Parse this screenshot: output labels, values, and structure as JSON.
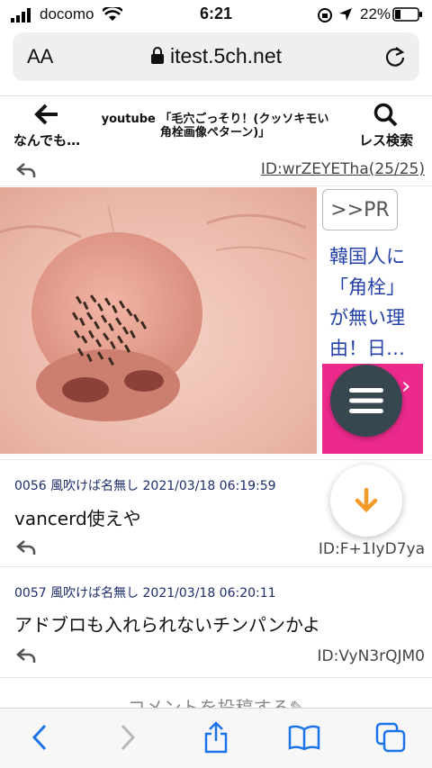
{
  "status_bar": {
    "carrier": "docomo",
    "time": "6:21",
    "battery": "22%"
  },
  "url_bar": {
    "text_size_label": "AA",
    "url": "itest.5ch.net"
  },
  "header": {
    "left_label": "なんでも…",
    "title": "youtube 「毛穴ごっそり！(クッソキモい角栓画像ペターン)」",
    "right_label": "レス検索"
  },
  "prev_post": {
    "id": "ID:wrZEYETha(25/25)"
  },
  "ad": {
    "pr_label": ">>PR",
    "headline": "韓国人に「角栓」が無い理由！日…"
  },
  "posts": [
    {
      "meta": "0056 風吹けば名無し 2021/03/18 06:19:59",
      "body": "vancerd使えや",
      "id": "ID:F+1IyD7ya"
    },
    {
      "meta": "0057 風吹けば名無し 2021/03/18 06:20:11",
      "body": "アドブロも入れられないチンパンかよ",
      "id": "ID:VyN3rQJM0"
    }
  ],
  "comment_prompt": "コメントを投稿する",
  "colors": {
    "accent_pink": "#ec2a8c",
    "link_blue": "#2542a8",
    "fab_dark": "#37474f",
    "fab_arrow": "#f39a2b"
  }
}
